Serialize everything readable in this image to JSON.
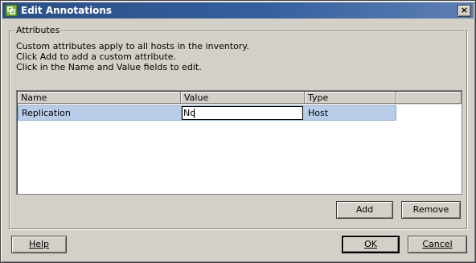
{
  "window": {
    "title": "Edit Annotations",
    "close_label": "×",
    "title_bar_colors": [
      "#2c4f86",
      "#5d7fb4"
    ]
  },
  "attributes": {
    "legend": "Attributes",
    "description": [
      "Custom attributes apply to all hosts in the inventory.",
      "Click Add to add a custom attribute.",
      "Click in the Name and Value fields to edit."
    ],
    "table": {
      "columns": [
        "Name",
        "Value",
        "Type"
      ],
      "rows": [
        {
          "name": "Replication",
          "value": "No",
          "type": "Host",
          "selected": true
        }
      ],
      "selection_color": "#b9cde8"
    },
    "add_label": "Add",
    "remove_label": "Remove"
  },
  "footer": {
    "help_label": "Help",
    "ok_label": "OK",
    "cancel_label": "Cancel"
  }
}
